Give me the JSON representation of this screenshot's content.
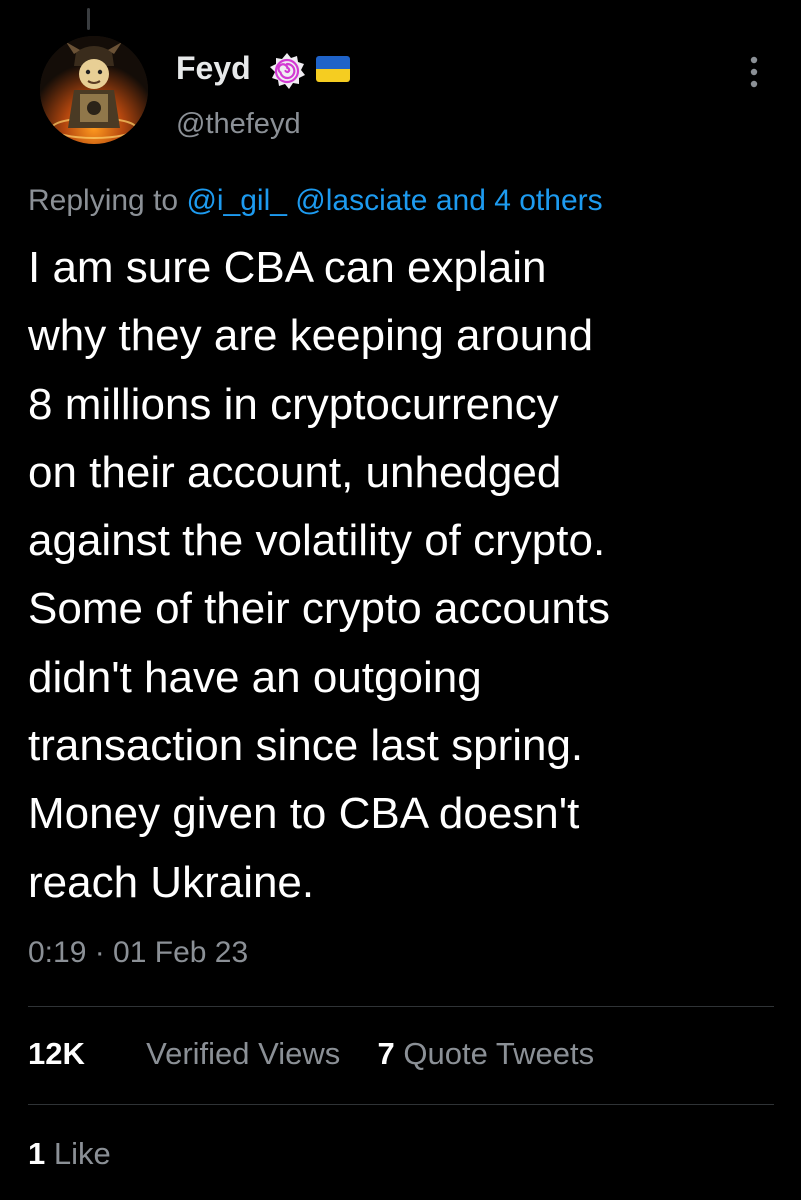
{
  "tweet": {
    "author": {
      "display_name": "Feyd",
      "handle": "@thefeyd",
      "badge_icon": "spiral-badge-icon",
      "flag_icon": "ukraine-flag-icon",
      "flag_colors": [
        "#1f63c9",
        "#f5cd21"
      ]
    },
    "reply": {
      "prefix": "Replying to",
      "mention_1": "@i_gil_",
      "mention_2": "@lasciate",
      "suffix": "and 4 others"
    },
    "text_lines": [
      "I am sure CBA can explain",
      "why they are keeping around",
      "8 millions in cryptocurrency",
      "on their account, unhedged",
      "against the volatility of crypto.",
      "Some of their crypto accounts",
      "didn't have an outgoing",
      "transaction since last spring.",
      "Money given to CBA doesn't",
      "reach Ukraine."
    ],
    "timestamp": "0:19 · 01 Feb 23",
    "stats": {
      "views_count": "12K",
      "views_label": "Verified Views",
      "quotes_count": "7",
      "quotes_label": "Quote Tweets",
      "likes_count": "1",
      "likes_label": "Like"
    }
  },
  "colors": {
    "background": "#000000",
    "text": "#ffffff",
    "muted": "#8b9096",
    "link": "#1d9bf0",
    "divider": "#2f3336"
  }
}
